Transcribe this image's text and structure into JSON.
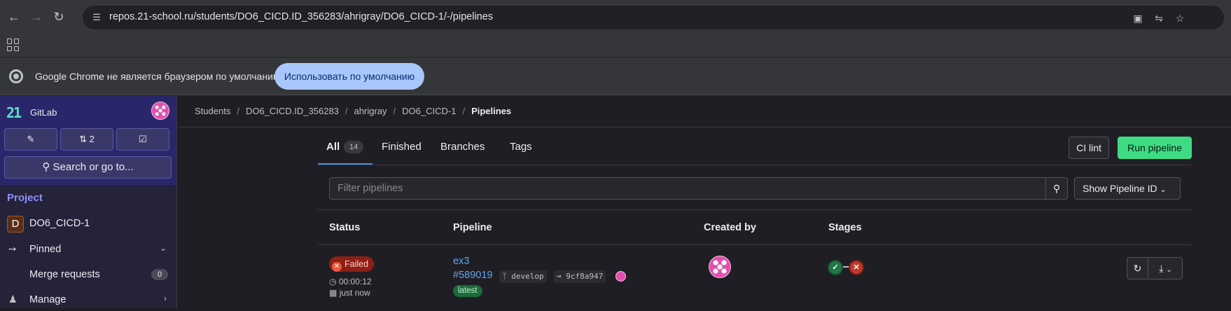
{
  "browser": {
    "url": "repos.21-school.ru/students/DO6_CICD.ID_356283/ahrigray/DO6_CICD-1/-/pipelines",
    "infobar_text": "Google Chrome не является браузером по умолчанию.",
    "default_button": "Использовать по умолчанию"
  },
  "sidebar": {
    "brand": "GitLab",
    "merge_requests_count": "2",
    "search_label": "Search or go to...",
    "section_heading": "Project",
    "project_initial": "D",
    "project_name": "DO6_CICD-1",
    "items": [
      {
        "label": "Pinned",
        "icon": "pin-icon"
      },
      {
        "label": "Merge requests",
        "count": "0"
      },
      {
        "label": "Manage",
        "icon": "manage-icon"
      }
    ]
  },
  "breadcrumb": [
    "Students",
    "DO6_CICD.ID_356283",
    "ahrigray",
    "DO6_CICD-1",
    "Pipelines"
  ],
  "tabs": [
    {
      "label": "All",
      "count": "14",
      "active": true
    },
    {
      "label": "Finished"
    },
    {
      "label": "Branches"
    },
    {
      "label": "Tags"
    }
  ],
  "buttons": {
    "ci_lint": "CI lint",
    "run_pipeline": "Run pipeline",
    "show_pipeline_id": "Show Pipeline ID"
  },
  "filter": {
    "placeholder": "Filter pipelines"
  },
  "table": {
    "headers": [
      "Status",
      "Pipeline",
      "Created by",
      "Stages"
    ],
    "rows": [
      {
        "status": "Failed",
        "duration": "00:00:12",
        "finished": "just now",
        "name": "ex3",
        "id": "#589019",
        "branch": "develop",
        "commit": "9cf8a947",
        "badge": "latest",
        "stages": [
          "success",
          "failed"
        ]
      }
    ]
  },
  "colors": {
    "accent_green": "#3ddc84",
    "failed_red": "#8d1f15",
    "link_blue": "#63a6e9",
    "sidebar_bg": "#29276a"
  }
}
